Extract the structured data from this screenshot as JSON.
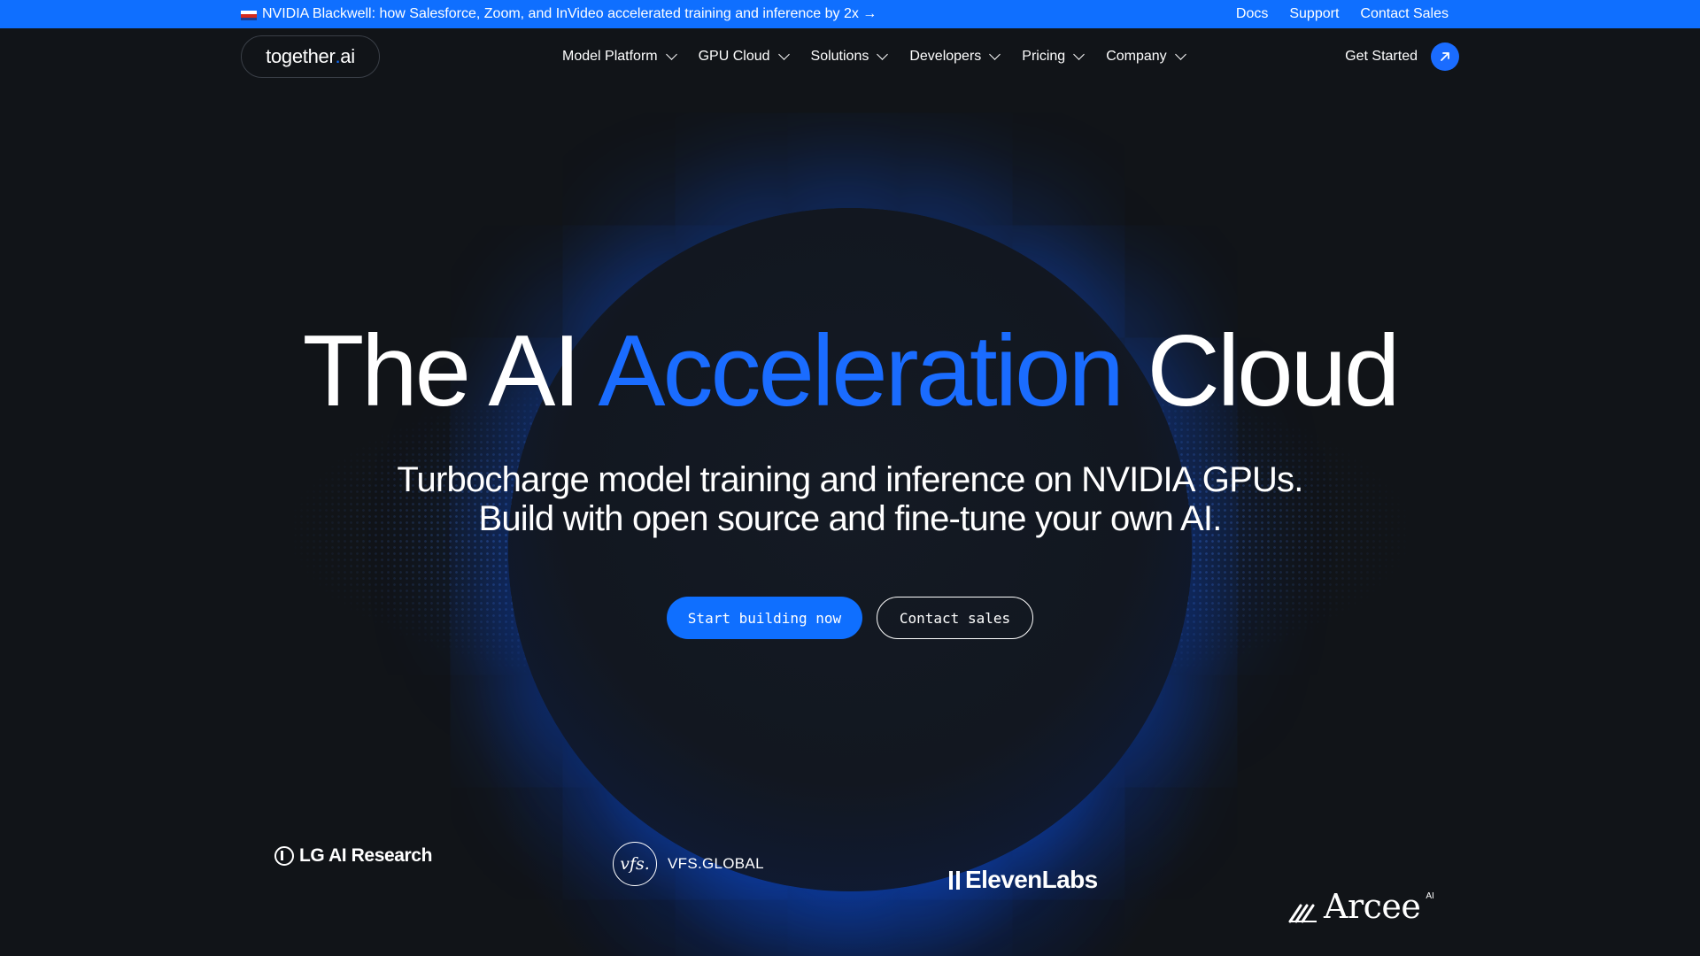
{
  "announcement": {
    "text": "NVIDIA Blackwell: how Salesforce, Zoom, and InVideo accelerated training and inference by 2x →",
    "links": [
      "Docs",
      "Support",
      "Contact Sales"
    ]
  },
  "nav": {
    "logo_text": "together",
    "logo_dot": ".",
    "logo_suffix": "ai",
    "menu": [
      "Model Platform",
      "GPU Cloud",
      "Solutions",
      "Developers",
      "Pricing",
      "Company"
    ],
    "cta": "Get Started"
  },
  "hero": {
    "title_pre": "The AI ",
    "title_accent": "Acceleration",
    "title_post": " Cloud",
    "subtitle_line1": "Turbocharge model training and inference on NVIDIA GPUs.",
    "subtitle_line2": "Build with open source and fine-tune your own AI.",
    "primary_button": "Start building now",
    "secondary_button": "Contact sales"
  },
  "customers": {
    "lg": "LG AI Research",
    "vfs_mark": "vfs.",
    "vfs": "VFS.GLOBAL",
    "eleven": "ElevenLabs",
    "arcee": "Arcee",
    "arcee_sup": "AI"
  },
  "colors": {
    "accent": "#0f6fff",
    "background": "#111418"
  }
}
